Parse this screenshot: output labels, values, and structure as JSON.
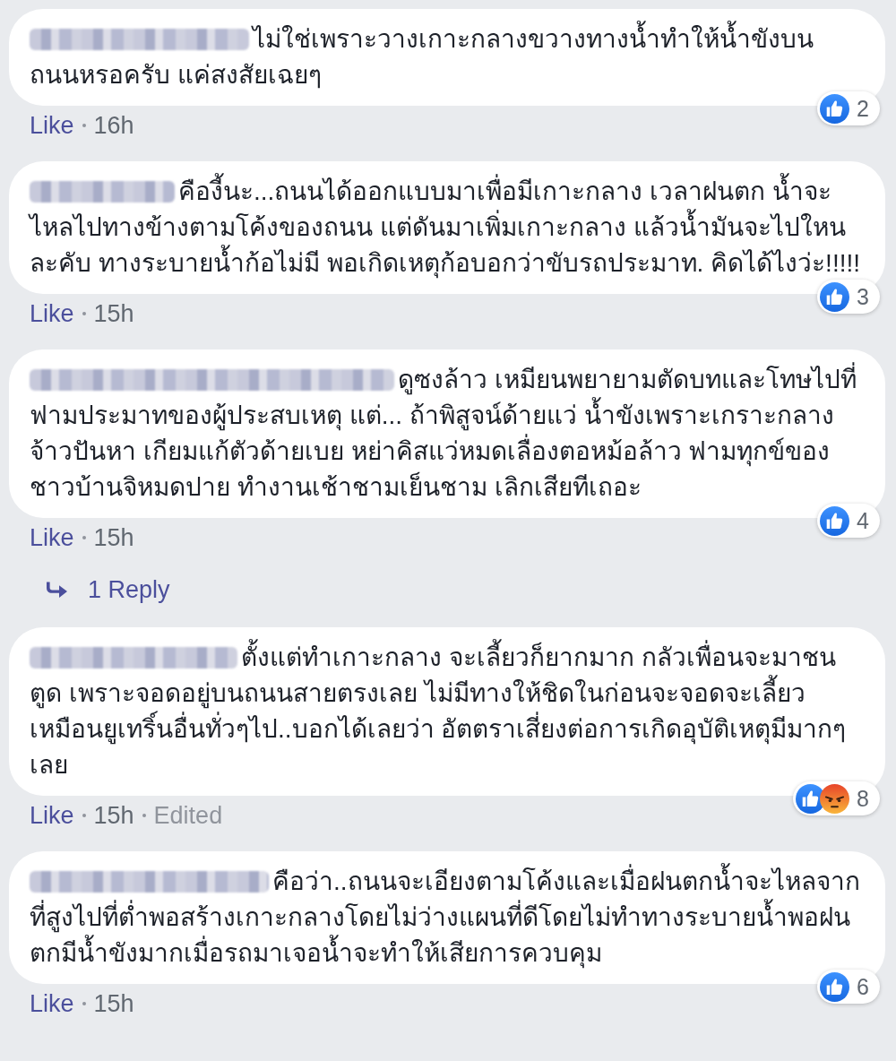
{
  "comments": [
    {
      "author_blurred": true,
      "text": "ไม่ใช่เพราะวางเกาะกลางขวางทางน้ำทำให้น้ำขังบนถนนหรอครับ แค่สงสัยเฉยๆ",
      "like_label": "Like",
      "time": "16h",
      "reactions": [
        {
          "kind": "like"
        }
      ],
      "reaction_count": "2"
    },
    {
      "author_blurred": true,
      "text": "คืองี้นะ...ถนนได้ออกแบบมาเพื่อมีเกาะกลาง เวลาฝนตก น้ำจะไหลไปทางข้างตามโค้งของถนน แต่ดันมาเพิ่มเกาะกลาง แล้วน้ำมันจะไปใหนละคับ ทางระบายน้ำก้อไม่มี พอเกิดเหตุก้อบอกว่าขับรถประมาท. คิดได้ไงว่ะ!!!!!",
      "like_label": "Like",
      "time": "15h",
      "reactions": [
        {
          "kind": "like"
        }
      ],
      "reaction_count": "3"
    },
    {
      "author_blurred": true,
      "text": "ดูซงล้าว เหมียนพยายามตัดบทและโทษไปที่ ฟามประมาทของผู้ประสบเหตุ แต่... ถ้าพิสูจน์ด้ายแว่ น้ำขังเพราะเกราะกลาง จ้าวปันหา เกียมแก้ตัวด้ายเบย หย่าคิสแว่หมดเลื่องตอหม้อล้าว ฟามทุกข์ของชาวบ้านจิหมดปาย ทำงานเช้าชามเย็นชาม เลิกเสียทีเถอะ",
      "like_label": "Like",
      "time": "15h",
      "reactions": [
        {
          "kind": "like"
        }
      ],
      "reaction_count": "4",
      "reply_link": "1 Reply"
    },
    {
      "author_blurred": true,
      "text": "ตั้งแต่ทำเกาะกลาง จะเลี้ยวก็ยากมาก กลัวเพื่อนจะมาชนตูด เพราะจอดอยู่บนถนนสายตรงเลย ไม่มีทางให้ชิดในก่อนจะจอดจะเลี้ยวเหมือนยูเทริ์นอื่นทั่วๆไป..บอกได้เลยว่า อัตตราเสี่ยงต่อการเกิดอุบัติเหตุมีมากๆเลย",
      "like_label": "Like",
      "time": "15h",
      "note": "Edited",
      "reactions": [
        {
          "kind": "like"
        },
        {
          "kind": "angry"
        }
      ],
      "reaction_count": "8"
    },
    {
      "author_blurred": true,
      "text": "คือว่า..ถนนจะเอียงตามโค้งและเมื่อฝนตกน้ำจะไหลจากที่สูงไปที่ต่ำพอสร้างเกาะกลางโดยไม่ว่างแผนที่ดีโดยไม่ทำทางระบายน้ำพอฝนตกมีน้ำขังมากเมื่อรถมาเจอน้ำจะทำให้เสียการควบคุม",
      "like_label": "Like",
      "time": "15h",
      "reactions": [
        {
          "kind": "like"
        }
      ],
      "reaction_count": "6"
    }
  ]
}
